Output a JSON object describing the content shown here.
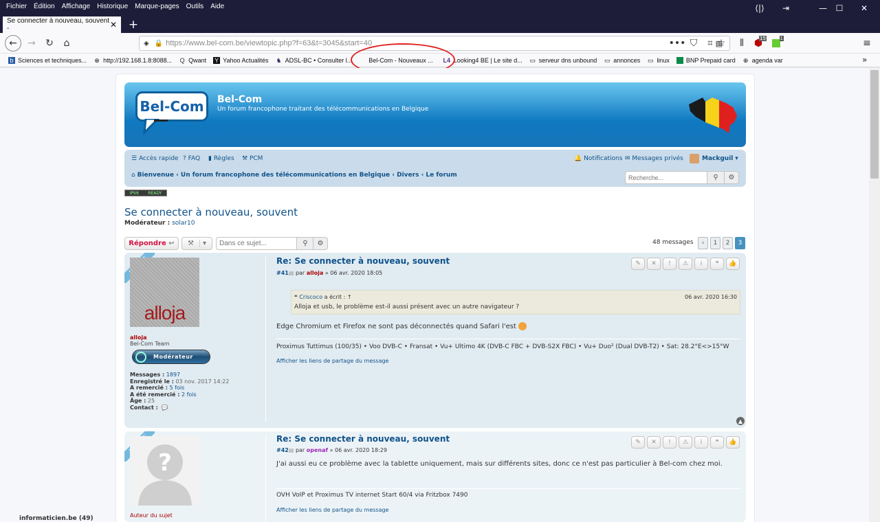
{
  "browser": {
    "menu": [
      "Fichier",
      "Édition",
      "Affichage",
      "Historique",
      "Marque-pages",
      "Outils",
      "Aide"
    ],
    "tab_title": "Se connecter à nouveau, souvent -",
    "new_tab": "+",
    "url": "https://www.bel-com.be/viewtopic.php?f=63&t=3045&start=40",
    "bookmarks": [
      {
        "label": "Sciences et techniques...",
        "icon": "b-icon"
      },
      {
        "label": "http://192.168.1.8:8088...",
        "icon": "globe-icon"
      },
      {
        "label": "Qwant",
        "icon": "qwant-icon"
      },
      {
        "label": "Yahoo Actualités",
        "icon": "yahoo-icon"
      },
      {
        "label": "ADSL-BC • Consulter l...",
        "icon": "adsl-icon"
      },
      {
        "label": "Bel-Com - Nouveaux ...",
        "icon": ""
      },
      {
        "label": "Looking4 BE | Le site d...",
        "icon": "l4-icon"
      },
      {
        "label": "serveur dns unbound",
        "icon": "folder-icon"
      },
      {
        "label": "annonces",
        "icon": "folder-icon"
      },
      {
        "label": "linux",
        "icon": "folder-icon"
      },
      {
        "label": "BNP Prepaid card",
        "icon": "bnp-icon"
      },
      {
        "label": "agenda var",
        "icon": "globe-icon"
      }
    ],
    "badge_ublock": "15",
    "badge_ext": "1"
  },
  "site": {
    "logo_text": "Bel-Com",
    "title": "Bel-Com",
    "description": "Un forum francophone traitant des télécommunications en Belgique"
  },
  "nav": {
    "quick": "Accès rapide",
    "faq": "FAQ",
    "rules": "Règles",
    "pcm": "PCM",
    "notifications": "Notifications",
    "private_messages": "Messages privés",
    "username": "Mackguil",
    "breadcrumb": [
      "Bienvenue",
      "Un forum francophone des télécommunications en Belgique",
      "Divers",
      "Le forum"
    ],
    "search_placeholder": "Recherche..."
  },
  "ipv6_badge": [
    "IPV6",
    "READY"
  ],
  "topic": {
    "title": "Se connecter à nouveau, souvent",
    "moderator_label": "Modérateur :",
    "moderator": "solar10",
    "reply_button": "Répondre",
    "search_placeholder": "Dans ce sujet...",
    "messages_count": "48 messages",
    "pages": [
      "1",
      "2",
      "3"
    ],
    "current_page": "3"
  },
  "posts": [
    {
      "online": "EN LIGNE",
      "avatar_text": "alloja",
      "author": "alloja",
      "rank": "Bel-Com Team",
      "rank_badge": "Modérateur",
      "profile": [
        {
          "label": "Messages :",
          "value": "1897",
          "link": true
        },
        {
          "label": "Enregistré le :",
          "value": "03 nov. 2017 14:22",
          "link": false
        },
        {
          "label": "A remercié :",
          "value": "5 fois",
          "link": true
        },
        {
          "label": "A été remercié :",
          "value": "2 fois",
          "link": true
        },
        {
          "label": "Âge :",
          "value": "25",
          "link": false
        },
        {
          "label": "Contact :",
          "value": "",
          "link": false
        }
      ],
      "title": "Re: Se connecter à nouveau, souvent",
      "number": "#41",
      "by": "par",
      "date": "» 06 avr. 2020 18:05",
      "quote": {
        "author": "Criscoco",
        "wrote": "a écrit : ↑",
        "date": "06 avr. 2020 16:30",
        "text": "Alloja et usb, le problème est-il aussi présent avec un autre navigateur ?"
      },
      "text": "Edge Chromium et Firefox ne sont pas déconnectés quand Safari l'est",
      "signature": "Proximus Tuttimus (100/35) • Voo DVB-C • Fransat • Vu+ Ultimo 4K (DVB-C FBC + DVB-S2X FBC) • Vu+ Duo² (Dual DVB-T2) • Sat: 28.2°E<>15°W",
      "share": "Afficher les liens de partage du message"
    },
    {
      "online": "EN LIGNE",
      "avatar_text": "?",
      "author_label": "Auteur du sujet",
      "title": "Re: Se connecter à nouveau, souvent",
      "number": "#42",
      "by": "par",
      "author": "openaf",
      "date": "» 06 avr. 2020 18:29",
      "text": "J'ai aussi eu ce problème avec la tablette uniquement, mais sur différents sites, donc ce n'est pas particulier à Bel-com chez moi.",
      "signature": "OVH VoIP et Proximus TV internet Start 60/4 via Fritzbox 7490",
      "share": "Afficher les liens de partage du message"
    }
  ],
  "taskbar_peek": "informaticien.be (49)",
  "colors": {
    "link": "#105289",
    "accent": "#d31141",
    "post_bg": "#e1ebf2"
  }
}
